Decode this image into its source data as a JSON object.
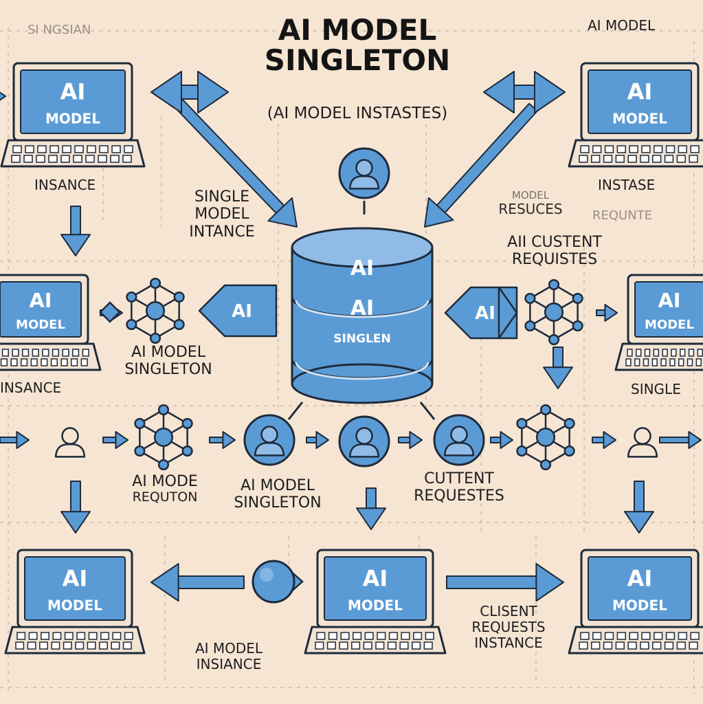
{
  "title": {
    "line1": "AI MODEL",
    "line2": "SINGLETON",
    "subtitle": "(AI MODEL INSTASTES)"
  },
  "corner_labels": {
    "top_left": "SI NGSIAN",
    "top_right": "AI MODEL"
  },
  "laptop": {
    "line1": "AI",
    "line2": "MODEL"
  },
  "database": {
    "line1": "AI",
    "line2": "AI",
    "line3": "SINGLEN"
  },
  "tag_text": "AI",
  "labels": {
    "insance": "INSANCE",
    "instase": "INSTASE",
    "single_model_instance": [
      "SINGLE",
      "MODEL",
      "INTANCE"
    ],
    "model_resuces": [
      "MODEL",
      "RESUCES"
    ],
    "requnte": "REQUNTE",
    "aii_custent_requistes": [
      "AII CUSTENT",
      "REQUISTES"
    ],
    "ai_model_singleton_left": [
      "AI MODEL",
      "SINGLETON"
    ],
    "insance_left": "INSANCE",
    "single_right": "SINGLE",
    "ai_mode_requton": [
      "AI MODE",
      "REQUTON"
    ],
    "ai_model_singleton_mid": [
      "AI MODEL",
      "SINGLETON"
    ],
    "cuttent_requestes": [
      "CUTTENT",
      "REQUESTES"
    ],
    "ai_model_insiance": [
      "AI MODEL",
      "INSIANCE"
    ],
    "clisent_requests_instance": [
      "CLISENT",
      "REQUESTS",
      "INSTANCE"
    ]
  },
  "colors": {
    "background": "#f6e5d3",
    "accent": "#5b9bd5",
    "outline": "#1e2a3a"
  }
}
